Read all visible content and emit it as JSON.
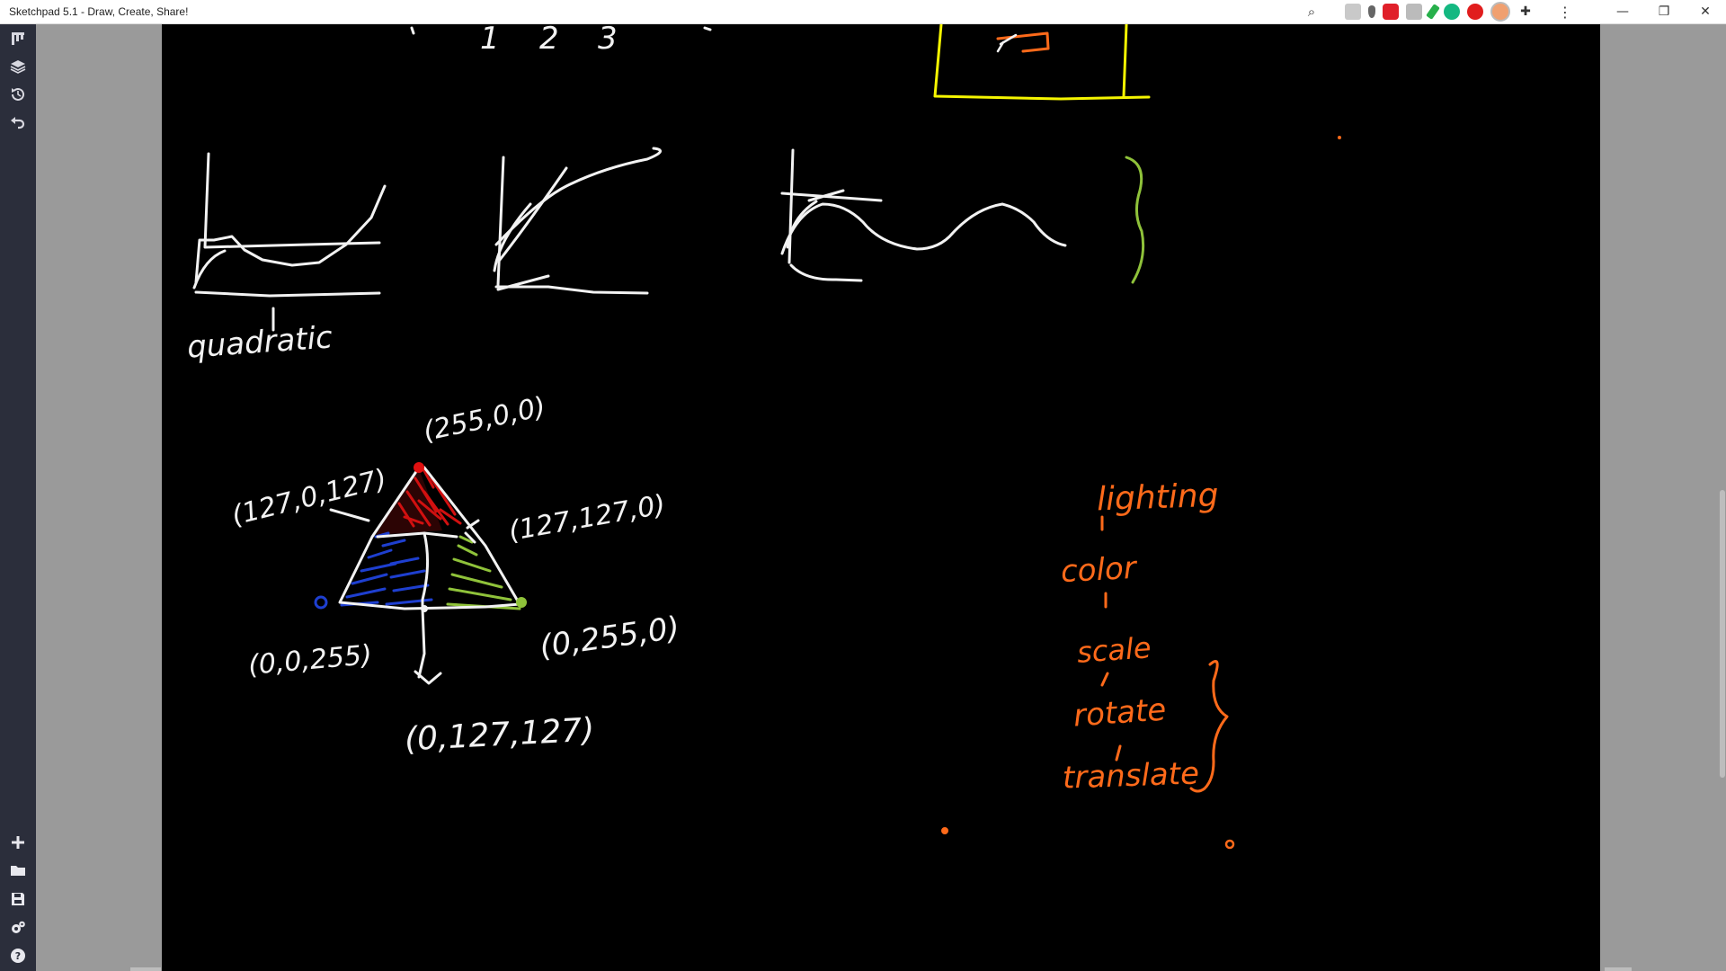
{
  "window": {
    "title": "Sketchpad 5.1 - Draw, Create, Share!",
    "controls": {
      "minimize": "—",
      "restore": "❐",
      "close": "✕"
    }
  },
  "extensions": {
    "zoom": "⌕",
    "menu": "⋮"
  },
  "toolbar": {
    "top_tools": [
      "tools-icon",
      "layers-icon",
      "history-icon",
      "undo-icon"
    ],
    "bottom_tools": [
      "new-icon",
      "open-folder-icon",
      "save-icon",
      "settings-icon",
      "help-icon"
    ]
  },
  "canvas": {
    "background": "#000000",
    "top_numbers": [
      "1",
      "2",
      "3"
    ],
    "graph_label": "quadratic",
    "triangle_labels": {
      "top": "(255,0,0)",
      "left_mid": "(127,0,127)",
      "right_mid": "(127,127,0)",
      "bottom_left": "(0,0,255)",
      "bottom_right": "(0,255,0)",
      "bottom_mid": "(0,127,127)"
    },
    "pipeline": [
      "lighting",
      "color",
      "scale",
      "rotate",
      "translate"
    ]
  },
  "colors": {
    "ink_white": "#f2f2f2",
    "ink_orange": "#ff6a1a",
    "ink_yellow": "#f5f500",
    "ink_green": "#8fc23a",
    "ink_red": "#e01010",
    "ink_blue": "#1e3fd0"
  }
}
